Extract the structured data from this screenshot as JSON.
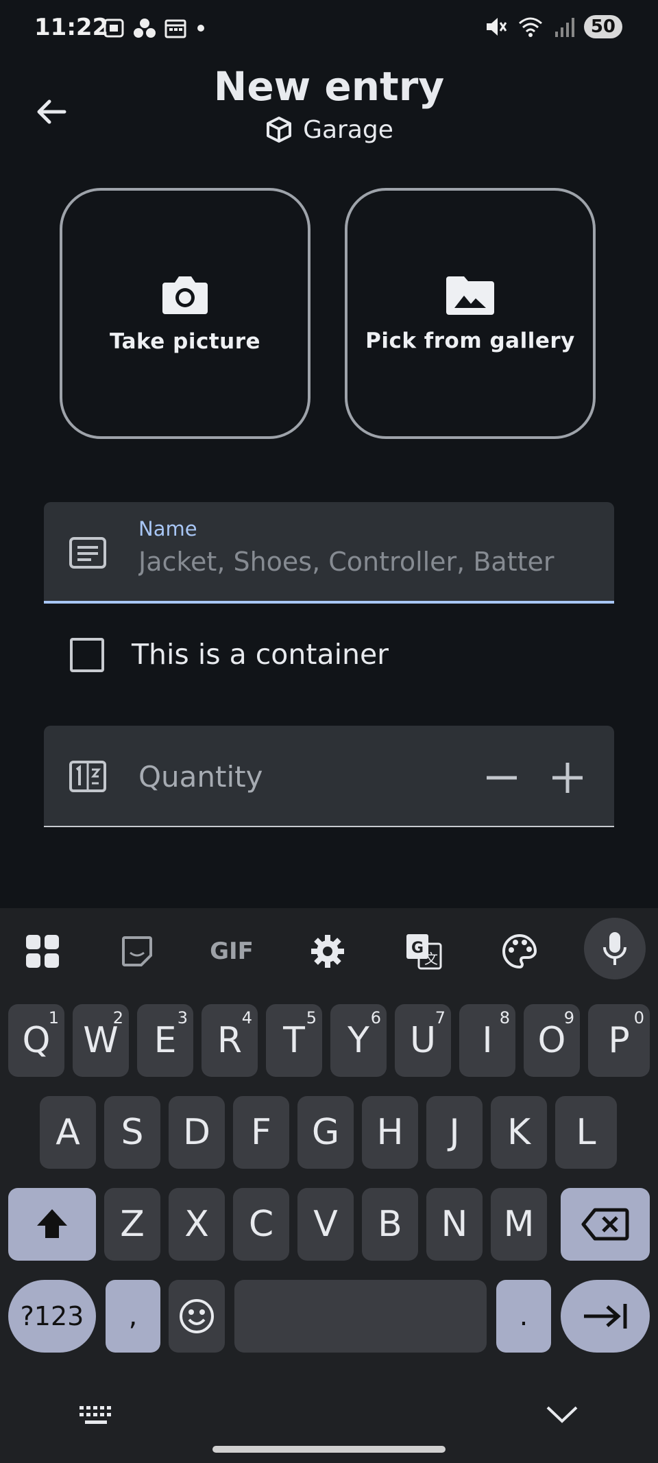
{
  "status_bar": {
    "time": "11:22",
    "battery": "50",
    "icons": [
      "screenshot-icon",
      "dots-icon",
      "calendar-icon",
      "notification-dot-icon",
      "mute-icon",
      "wifi-icon",
      "signal-icon"
    ]
  },
  "header": {
    "title": "New entry",
    "subtitle": "Garage",
    "subtitle_icon": "cube-icon"
  },
  "photo_actions": {
    "take_picture": "Take picture",
    "pick_gallery": "Pick from gallery"
  },
  "name_field": {
    "label": "Name",
    "placeholder": "Jacket, Shoes, Controller, Batter",
    "value": ""
  },
  "container_checkbox": {
    "label": "This is a container",
    "checked": false
  },
  "quantity_field": {
    "label": "Quantity"
  },
  "keyboard": {
    "toolbar": [
      "apps-icon",
      "sticker-icon",
      "gif-icon",
      "settings-icon",
      "translate-icon",
      "palette-icon",
      "mic-icon"
    ],
    "gif_label": "GIF",
    "row1": [
      "Q",
      "W",
      "E",
      "R",
      "T",
      "Y",
      "U",
      "I",
      "O",
      "P"
    ],
    "row1_hints": [
      "1",
      "2",
      "3",
      "4",
      "5",
      "6",
      "7",
      "8",
      "9",
      "0"
    ],
    "row2": [
      "A",
      "S",
      "D",
      "F",
      "G",
      "H",
      "J",
      "K",
      "L"
    ],
    "row3": [
      "Z",
      "X",
      "C",
      "V",
      "B",
      "N",
      "M"
    ],
    "symbols": "?123",
    "comma": ",",
    "period": "."
  },
  "colors": {
    "background": "#111418",
    "field_bg": "#2d3136",
    "accent": "#a8c6f5",
    "key_bg": "#3b3d42",
    "mod_key_bg": "#a7adc7"
  }
}
